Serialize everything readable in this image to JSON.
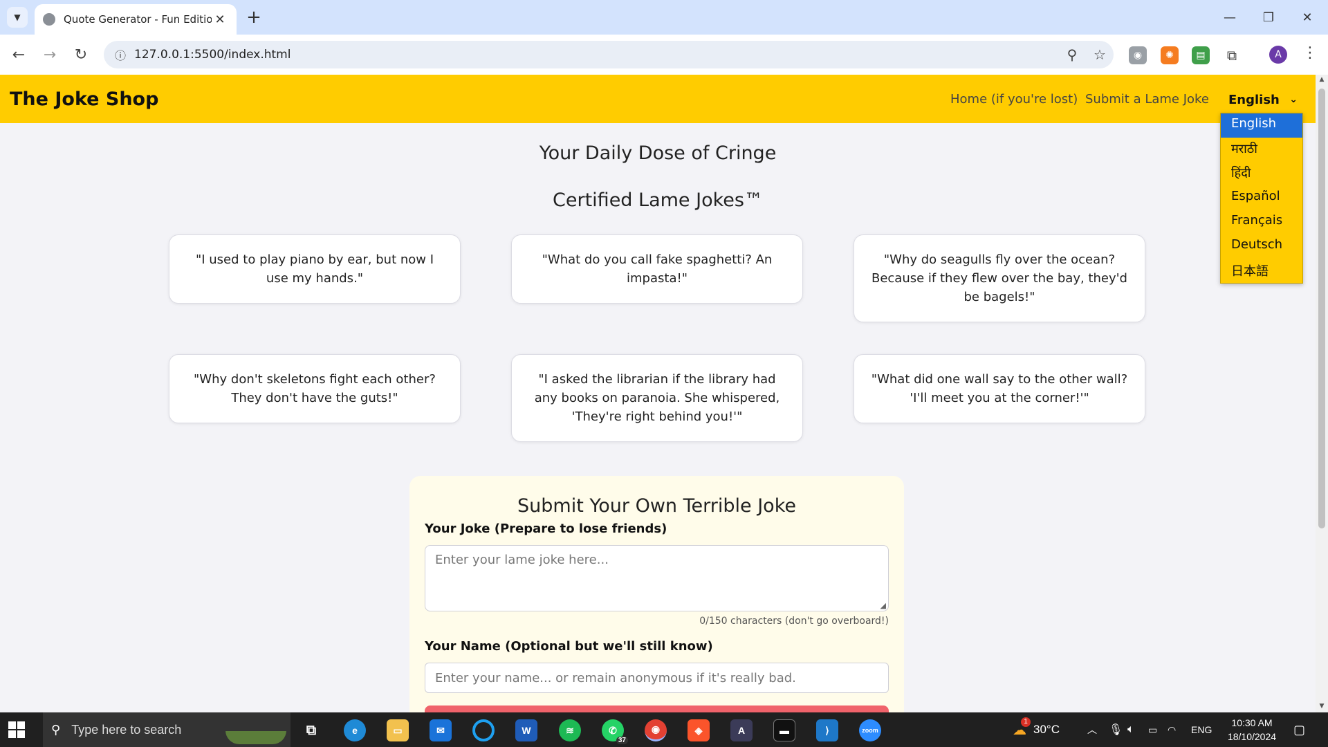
{
  "browser": {
    "tab_title": "Quote Generator - Fun Edition",
    "url": "127.0.0.1:5500/index.html",
    "profile_initial": "A"
  },
  "site": {
    "brand": "The Joke Shop",
    "nav": [
      "Home (if you're lost)",
      "Submit a Lame Joke"
    ],
    "language_selected": "English",
    "languages": [
      "English",
      "मराठी",
      "हिंदी",
      "Español",
      "Français",
      "Deutsch",
      "日本語"
    ],
    "heading1": "Your Daily Dose of Cringe",
    "heading2": "Certified Lame Jokes™",
    "jokes": [
      "\"I used to play piano by ear, but now I use my hands.\"",
      "\"What do you call fake spaghetti? An impasta!\"",
      "\"Why do seagulls fly over the ocean? Because if they flew over the bay, they'd be bagels!\"",
      "\"Why don't skeletons fight each other? They don't have the guts!\"",
      "\"I asked the librarian if the library had any books on paranoia. She whispered, 'They're right behind you!'\"",
      "\"What did one wall say to the other wall? 'I'll meet you at the corner!'\""
    ],
    "form": {
      "title": "Submit Your Own Terrible Joke",
      "joke_label": "Your Joke (Prepare to lose friends)",
      "joke_placeholder": "Enter your lame joke here...",
      "counter": "0/150 characters (don't go overboard!)",
      "name_label": "Your Name (Optional but we'll still know)",
      "name_placeholder": "Enter your name... or remain anonymous if it's really bad."
    }
  },
  "taskbar": {
    "search_placeholder": "Type here to search",
    "whatsapp_badge": "37",
    "weather_badge": "1",
    "temperature": "30°C",
    "language": "ENG",
    "time": "10:30 AM",
    "date": "18/10/2024"
  },
  "colors": {
    "header": "#ffcc00",
    "selected_option": "#1e6fd9",
    "form_bg": "#fffcea",
    "submit_button": "#f0636b"
  }
}
